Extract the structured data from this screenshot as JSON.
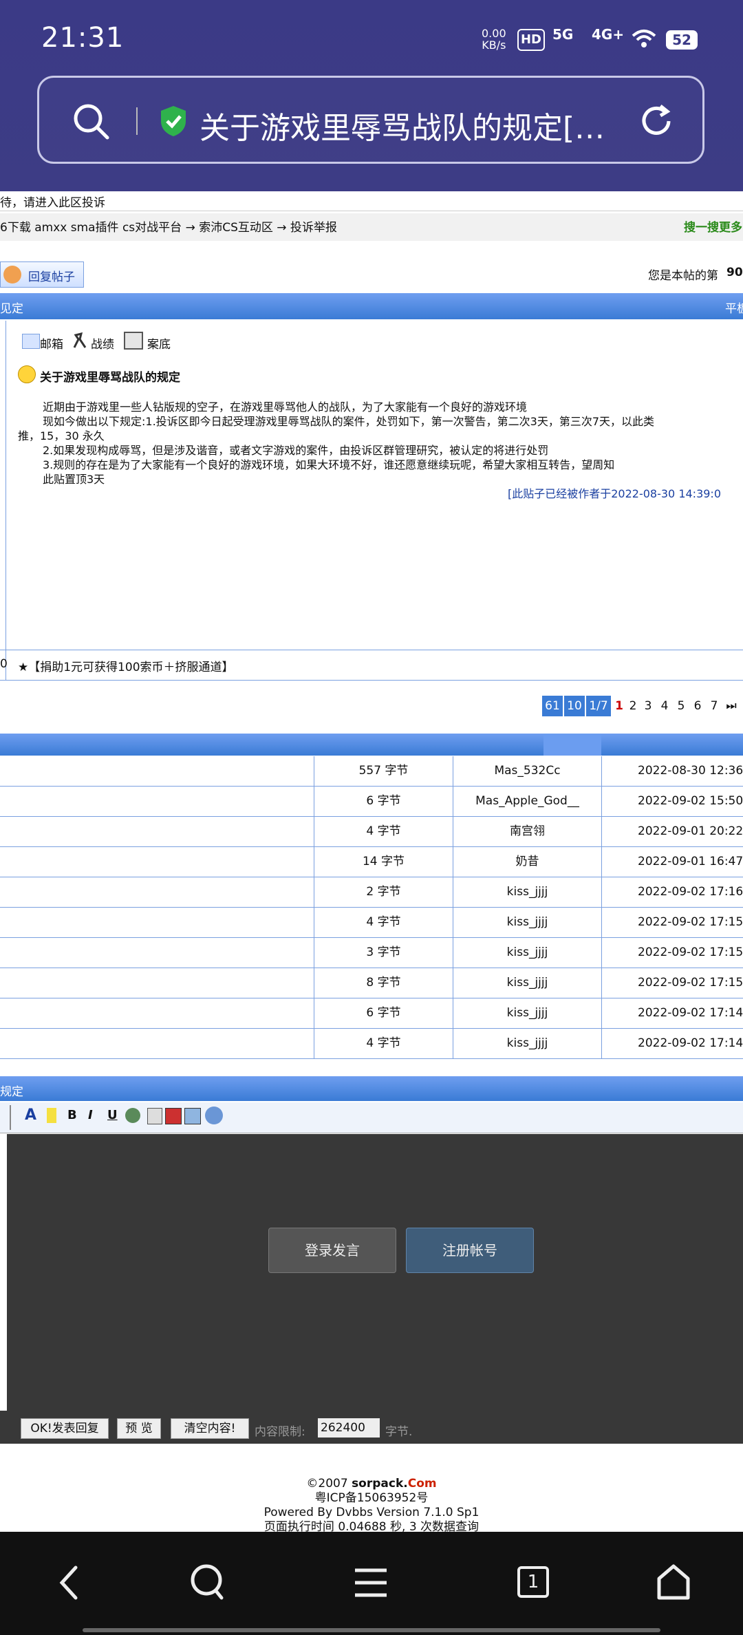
{
  "status_bar": {
    "time": "21:31",
    "net_speed": "0.00\nKB/s",
    "hd": "HD",
    "sig1": "5G",
    "sig2": "4G+",
    "battery": "52"
  },
  "address_bar": {
    "title": "关于游戏里辱骂战队的规定[…"
  },
  "top_notice": "待，请进入此区投诉",
  "breadcrumb": "6下载 amxx sma插件 cs对战平台 → 索沛CS互动区 → 投诉举报",
  "search_more": "搜一搜更多",
  "reply_button": "回复帖子",
  "post_count_label": "您是本帖的第",
  "post_count_value": "90",
  "title_bar_left": "见定",
  "title_bar_right": "平板",
  "post_links": {
    "mail": "邮箱",
    "record": "战绩",
    "file": "案底"
  },
  "post_title": "关于游戏里辱骂战队的规定",
  "post_body": [
    "近期由于游戏里一些人钻版规的空子，在游戏里辱骂他人的战队，为了大家能有一个良好的游戏环境",
    "现如今做出以下规定:1.投诉区即今日起受理游戏里辱骂战队的案件，处罚如下，第一次警告，第二次3天，第三次7天，以此类",
    "推，15，30 永久",
    "2.如果发现构成辱骂，但是涉及谐音，或者文字游戏的案件，由投诉区群管理研究，被认定的将进行处罚",
    "3.规则的存在是为了大家能有一个良好的游戏环境，如果大环境不好，谁还愿意继续玩呢，希望大家相互转告，望周知",
    "此贴置顶3天"
  ],
  "edited_note": "[此贴子已经被作者于2022-08-30 14:39:0",
  "signature_prefix": "0",
  "signature": "★【捐助1元可获得100索币＋挤服通道】",
  "pagination": {
    "first": "61",
    "count": "10",
    "page": "1/7",
    "pages": [
      "1",
      "2",
      "3",
      "4",
      "5",
      "6",
      "7"
    ],
    "last": "⏭"
  },
  "table_rows": [
    {
      "size": "557 字节",
      "author": "Mas_532Cc",
      "time": "2022-08-30 12:36"
    },
    {
      "size": "6 字节",
      "author": "Mas_Apple_God__",
      "time": "2022-09-02 15:50"
    },
    {
      "size": "4 字节",
      "author": "南宫翎",
      "time": "2022-09-01 20:22"
    },
    {
      "size": "14 字节",
      "author": "奶昔",
      "time": "2022-09-01 16:47"
    },
    {
      "size": "2 字节",
      "author": "kiss_jjjj",
      "time": "2022-09-02 17:16"
    },
    {
      "size": "4 字节",
      "author": "kiss_jjjj",
      "time": "2022-09-02 17:15"
    },
    {
      "size": "3 字节",
      "author": "kiss_jjjj",
      "time": "2022-09-02 17:15"
    },
    {
      "size": "8 字节",
      "author": "kiss_jjjj",
      "time": "2022-09-02 17:15"
    },
    {
      "size": "6 字节",
      "author": "kiss_jjjj",
      "time": "2022-09-02 17:14"
    },
    {
      "size": "4 字节",
      "author": "kiss_jjjj",
      "time": "2022-09-02 17:14"
    }
  ],
  "reply_bar_title": "规定",
  "login_button": "登录发言",
  "register_button": "注册帐号",
  "bottom_buttons": {
    "submit": "OK!发表回复",
    "preview": "预 览",
    "clear": "清空内容!"
  },
  "limit_label": "内容限制:",
  "limit_value": "262400",
  "limit_unit": "字节.",
  "footer": {
    "copyright": "©2007",
    "site": "sorpack.",
    "site_tld": "Com",
    "icp": "粤ICP备15063952号",
    "powered": "Powered By Dvbbs Version 7.1.0 Sp1",
    "exec": "页面执行时间 0.04688 秒, 3 次数据查询"
  },
  "nav": {
    "tab_count": "1"
  },
  "colors": {
    "header_bg": "#3b3a86",
    "bar_blue": "#3a7bd5",
    "link_green": "#2a8a1a",
    "footer_red": "#cc2200"
  }
}
